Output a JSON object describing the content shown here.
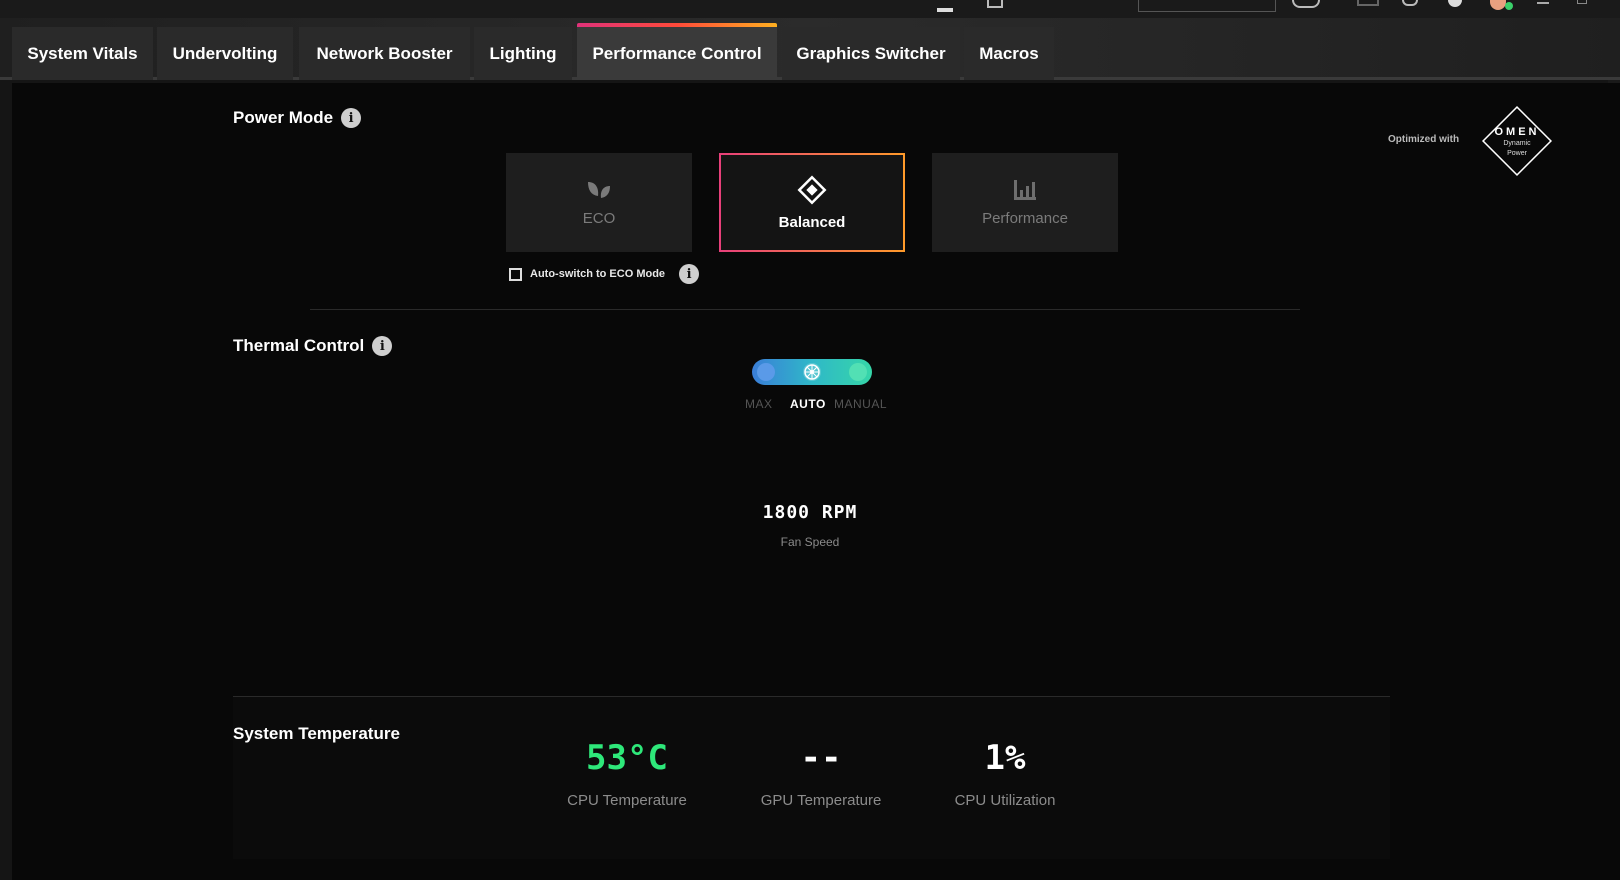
{
  "tabs": [
    {
      "label": "System Vitals",
      "active": false
    },
    {
      "label": "Undervolting",
      "active": false
    },
    {
      "label": "Network Booster",
      "active": false
    },
    {
      "label": "Lighting",
      "active": false
    },
    {
      "label": "Performance Control",
      "active": true
    },
    {
      "label": "Graphics Switcher",
      "active": false
    },
    {
      "label": "Macros",
      "active": false
    }
  ],
  "power_mode": {
    "title": "Power Mode",
    "modes": [
      {
        "label": "ECO",
        "icon": "leaf-icon",
        "selected": false
      },
      {
        "label": "Balanced",
        "icon": "diamond-icon",
        "selected": true
      },
      {
        "label": "Performance",
        "icon": "bars-icon",
        "selected": false
      }
    ],
    "auto_switch_label": "Auto-switch to ECO Mode",
    "auto_switch_checked": false
  },
  "branding": {
    "optimized_label": "Optimized with",
    "logo_text": "OMEN",
    "logo_sub1": "Dynamic",
    "logo_sub2": "Power"
  },
  "thermal": {
    "title": "Thermal Control",
    "options": [
      "MAX",
      "AUTO",
      "MANUAL"
    ],
    "selected": "AUTO",
    "fan_speed": "1800 RPM",
    "fan_speed_label": "Fan Speed"
  },
  "system_temperature": {
    "title": "System Temperature",
    "metrics": [
      {
        "value": "53°C",
        "label": "CPU Temperature",
        "color": "#2ee87a"
      },
      {
        "value": "--",
        "label": "GPU Temperature",
        "color": "#ffffff"
      },
      {
        "value": "1%",
        "label": "CPU Utilization",
        "color": "#ffffff"
      }
    ]
  },
  "colors": {
    "accent_start": "#e8407a",
    "accent_end": "#ff9a2a",
    "toggle_start": "#3a7ed8",
    "toggle_end": "#36d6a8",
    "cpu_temp": "#2ee87a"
  }
}
